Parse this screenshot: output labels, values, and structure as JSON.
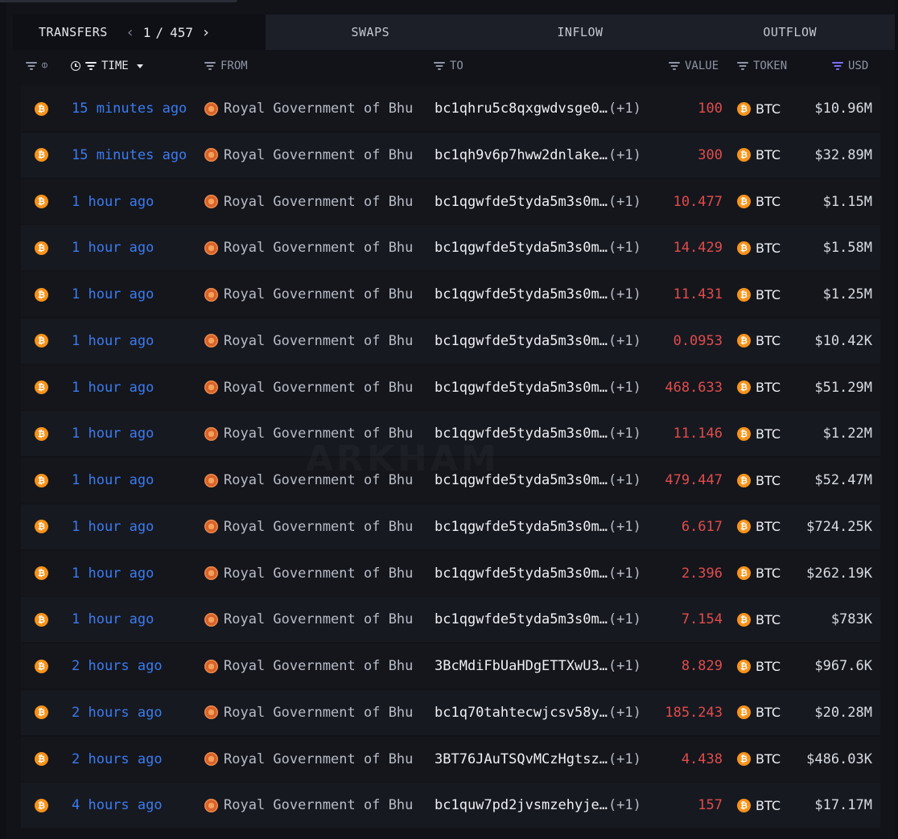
{
  "tabs": {
    "transfers": "TRANSFERS",
    "swaps": "SWAPS",
    "inflow": "INFLOW",
    "outflow": "OUTFLOW"
  },
  "pager": {
    "current": "1",
    "separator": "/",
    "total": "457"
  },
  "columns": {
    "time": "TIME",
    "from": "FROM",
    "to": "TO",
    "value": "VALUE",
    "token": "TOKEN",
    "usd": "USD"
  },
  "icons": {
    "row_chain": "bitcoin-icon",
    "entity": "royal-government-of-bhutan-seal-icon",
    "token": "bitcoin-icon",
    "filter": "filter-icon",
    "link": "link-icon",
    "clock": "clock-icon"
  },
  "colors": {
    "time_link": "#3c7bf0",
    "value_out": "#e04c4c",
    "btc": "#f7931a",
    "usd_sort_active": "#7b6ef6"
  },
  "rows": [
    {
      "time": "15 minutes ago",
      "from": "Royal Government of Bhu",
      "to": "bc1qhru5c8qxgwdvsge0…",
      "to_extra": "(+1)",
      "value": "100",
      "token": "BTC",
      "usd": "$10.96M"
    },
    {
      "time": "15 minutes ago",
      "from": "Royal Government of Bhu",
      "to": "bc1qh9v6p7hww2dnlake…",
      "to_extra": "(+1)",
      "value": "300",
      "token": "BTC",
      "usd": "$32.89M"
    },
    {
      "time": "1 hour ago",
      "from": "Royal Government of Bhu",
      "to": "bc1qgwfde5tyda5m3s0m…",
      "to_extra": "(+1)",
      "value": "10.477",
      "token": "BTC",
      "usd": "$1.15M"
    },
    {
      "time": "1 hour ago",
      "from": "Royal Government of Bhu",
      "to": "bc1qgwfde5tyda5m3s0m…",
      "to_extra": "(+1)",
      "value": "14.429",
      "token": "BTC",
      "usd": "$1.58M"
    },
    {
      "time": "1 hour ago",
      "from": "Royal Government of Bhu",
      "to": "bc1qgwfde5tyda5m3s0m…",
      "to_extra": "(+1)",
      "value": "11.431",
      "token": "BTC",
      "usd": "$1.25M"
    },
    {
      "time": "1 hour ago",
      "from": "Royal Government of Bhu",
      "to": "bc1qgwfde5tyda5m3s0m…",
      "to_extra": "(+1)",
      "value": "0.0953",
      "token": "BTC",
      "usd": "$10.42K"
    },
    {
      "time": "1 hour ago",
      "from": "Royal Government of Bhu",
      "to": "bc1qgwfde5tyda5m3s0m…",
      "to_extra": "(+1)",
      "value": "468.633",
      "token": "BTC",
      "usd": "$51.29M"
    },
    {
      "time": "1 hour ago",
      "from": "Royal Government of Bhu",
      "to": "bc1qgwfde5tyda5m3s0m…",
      "to_extra": "(+1)",
      "value": "11.146",
      "token": "BTC",
      "usd": "$1.22M"
    },
    {
      "time": "1 hour ago",
      "from": "Royal Government of Bhu",
      "to": "bc1qgwfde5tyda5m3s0m…",
      "to_extra": "(+1)",
      "value": "479.447",
      "token": "BTC",
      "usd": "$52.47M"
    },
    {
      "time": "1 hour ago",
      "from": "Royal Government of Bhu",
      "to": "bc1qgwfde5tyda5m3s0m…",
      "to_extra": "(+1)",
      "value": "6.617",
      "token": "BTC",
      "usd": "$724.25K"
    },
    {
      "time": "1 hour ago",
      "from": "Royal Government of Bhu",
      "to": "bc1qgwfde5tyda5m3s0m…",
      "to_extra": "(+1)",
      "value": "2.396",
      "token": "BTC",
      "usd": "$262.19K"
    },
    {
      "time": "1 hour ago",
      "from": "Royal Government of Bhu",
      "to": "bc1qgwfde5tyda5m3s0m…",
      "to_extra": "(+1)",
      "value": "7.154",
      "token": "BTC",
      "usd": "$783K"
    },
    {
      "time": "2 hours ago",
      "from": "Royal Government of Bhu",
      "to": "3BcMdiFbUaHDgETTXwU3…",
      "to_extra": "(+1)",
      "value": "8.829",
      "token": "BTC",
      "usd": "$967.6K"
    },
    {
      "time": "2 hours ago",
      "from": "Royal Government of Bhu",
      "to": "bc1q70tahtecwjcsv58y…",
      "to_extra": "(+1)",
      "value": "185.243",
      "token": "BTC",
      "usd": "$20.28M"
    },
    {
      "time": "2 hours ago",
      "from": "Royal Government of Bhu",
      "to": "3BT76JAuTSQvMCzHgtsz…",
      "to_extra": "(+1)",
      "value": "4.438",
      "token": "BTC",
      "usd": "$486.03K"
    },
    {
      "time": "4 hours ago",
      "from": "Royal Government of Bhu",
      "to": "bc1quw7pd2jvsmzehyje…",
      "to_extra": "(+1)",
      "value": "157",
      "token": "BTC",
      "usd": "$17.17M"
    }
  ],
  "watermark": "ARKHAM"
}
